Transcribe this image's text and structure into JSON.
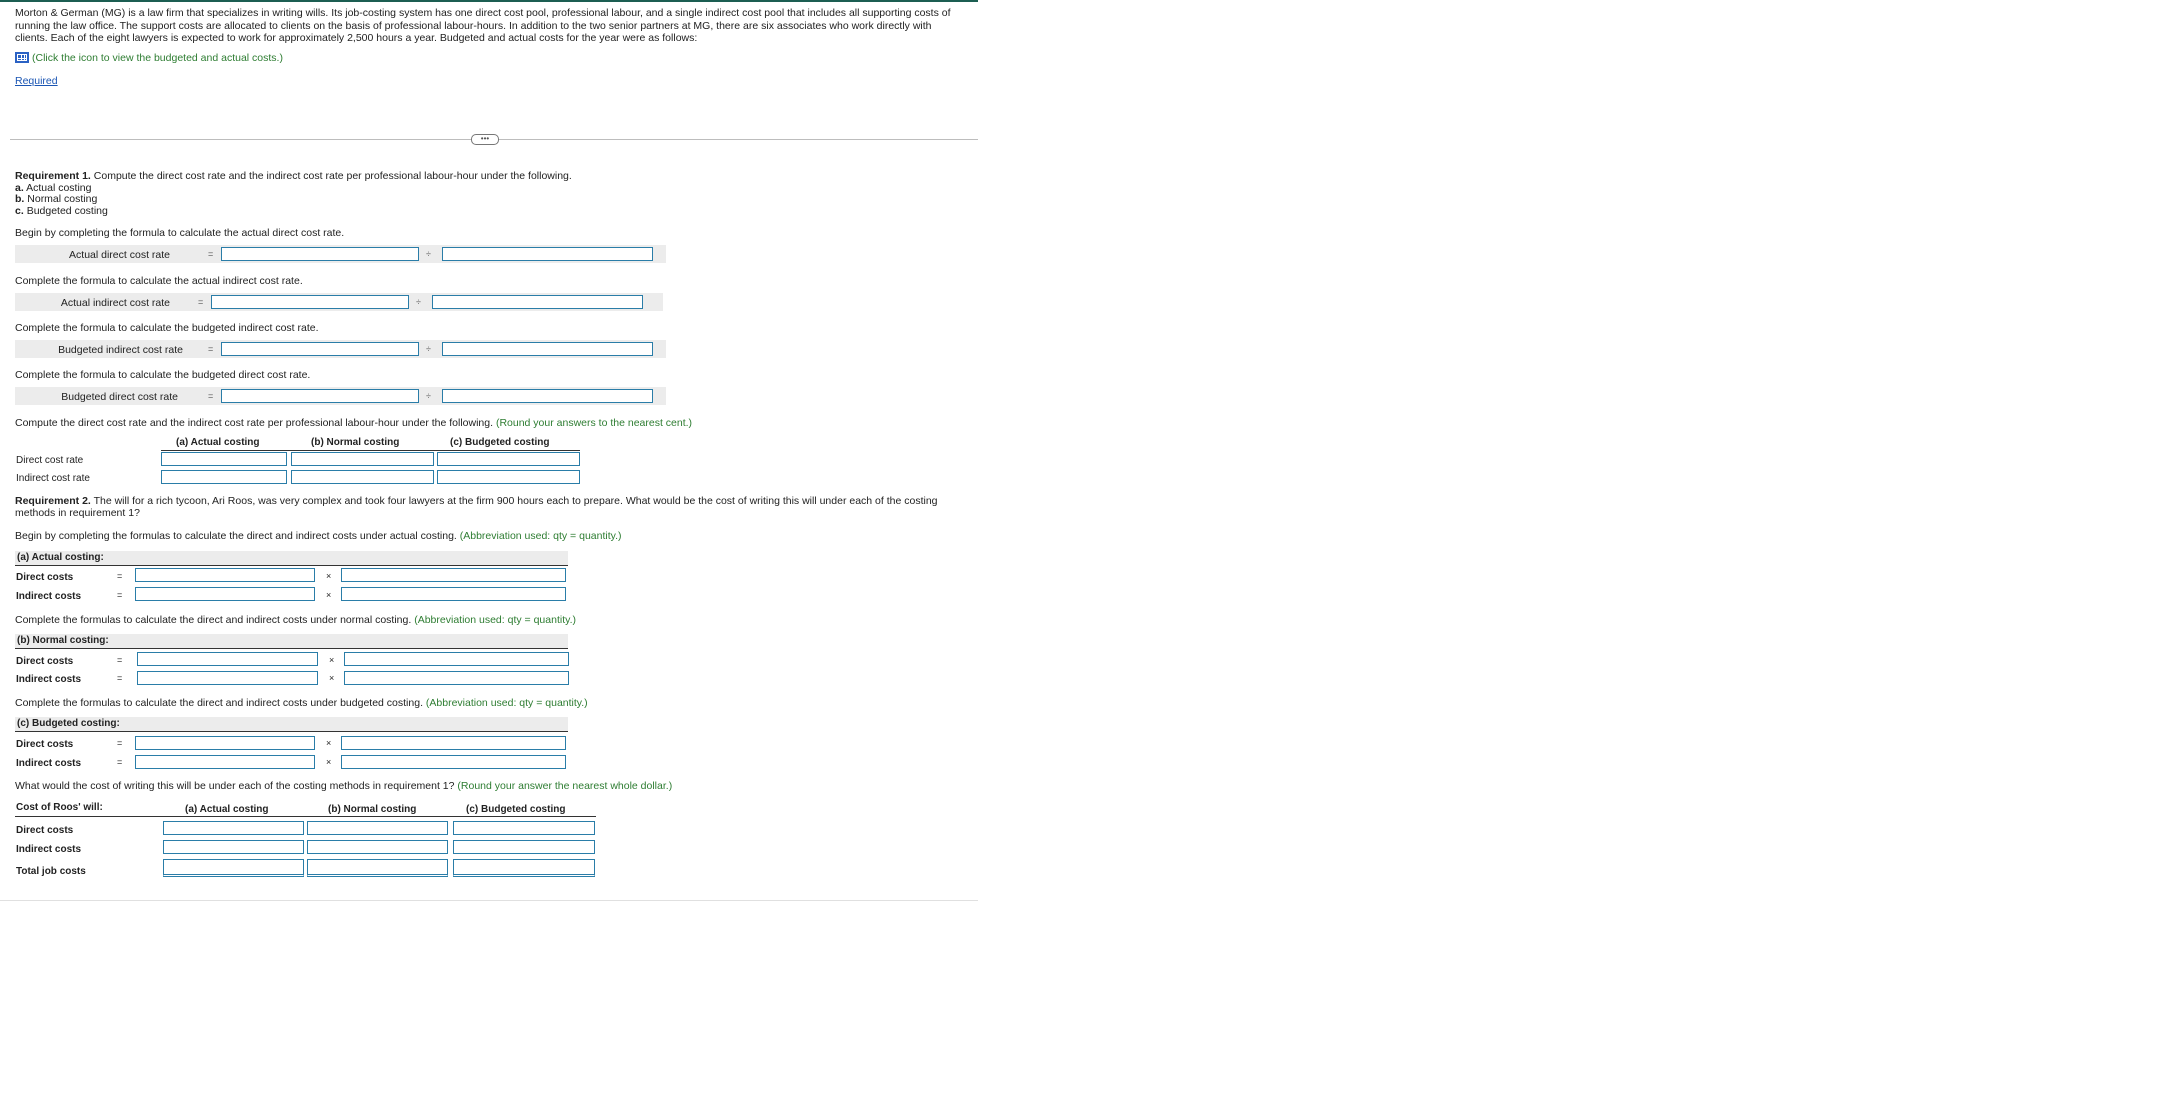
{
  "intro": "Morton & German (MG) is a law firm that specializes in writing wills. Its job-costing system has one direct cost pool, professional labour, and a single indirect cost pool that includes all supporting costs of running the law office. The support costs are allocated to clients on the basis of professional labour-hours. In addition to the two senior partners at MG, there are six associates who work directly with clients. Each of the eight lawyers is expected to work for approximately 2,500 hours a year. Budgeted and actual costs for the year were as follows:",
  "table_hint": "(Click the icon to view the budgeted and actual costs.)",
  "required_link": "Required",
  "handle_glyph": "•••",
  "ops": {
    "eq": "=",
    "div": "÷",
    "times": "×"
  },
  "req1": {
    "heading_bold": "Requirement 1.",
    "heading_text": "Compute the direct cost rate and the indirect cost rate per professional labour-hour under the following.",
    "opt_a_letter": "a.",
    "opt_a": "Actual costing",
    "opt_b_letter": "b.",
    "opt_b": "Normal costing",
    "opt_c_letter": "c.",
    "opt_c": "Budgeted costing",
    "instr_actual_direct": "Begin by completing the formula to calculate the actual direct cost rate.",
    "label_actual_direct": "Actual direct cost rate",
    "instr_actual_indirect": "Complete the formula to calculate the actual indirect cost rate.",
    "label_actual_indirect": "Actual indirect cost rate",
    "instr_budgeted_indirect": "Complete the formula to calculate the budgeted indirect cost rate.",
    "label_budgeted_indirect": "Budgeted indirect cost rate",
    "instr_budgeted_direct": "Complete the formula to calculate the budgeted direct cost rate.",
    "label_budgeted_direct": "Budgeted direct cost rate",
    "compute_rates": "Compute the direct cost rate and the indirect cost rate per professional labour-hour under the following.",
    "compute_rates_hint": "(Round your answers to the nearest cent.)"
  },
  "cols": {
    "actual": "(a) Actual costing",
    "normal": "(b) Normal costing",
    "budgeted": "(c) Budgeted costing"
  },
  "rates": {
    "row_direct": "Direct cost rate",
    "row_indirect": "Indirect cost rate"
  },
  "req2": {
    "heading_bold": "Requirement 2.",
    "heading_text": "The will for a rich tycoon, Ari Roos, was very complex and took four lawyers at the firm 900 hours each to prepare. What would be the cost of writing this will under each of the costing methods in requirement 1?",
    "instr_actual": "Begin by completing the formulas to calculate the direct and indirect costs under actual costing.",
    "instr_normal": "Complete the formulas to calculate the direct and indirect costs under normal costing.",
    "instr_budgeted": "Complete the formulas to calculate the direct and indirect costs under budgeted costing.",
    "abbr_hint": "(Abbreviation used: qty = quantity.)",
    "sec_actual": "(a) Actual costing:",
    "sec_normal": "(b) Normal costing:",
    "sec_budgeted": "(c) Budgeted costing:",
    "direct_costs": "Direct costs",
    "indirect_costs": "Indirect costs",
    "cost_question": "What would the cost of writing this will be under each of the costing methods in requirement 1?",
    "cost_hint": "(Round your answer the nearest whole dollar.)"
  },
  "cost_table": {
    "title": "Cost of Roos' will:",
    "row_direct": "Direct costs",
    "row_indirect": "Indirect costs",
    "row_total": "Total job costs"
  }
}
